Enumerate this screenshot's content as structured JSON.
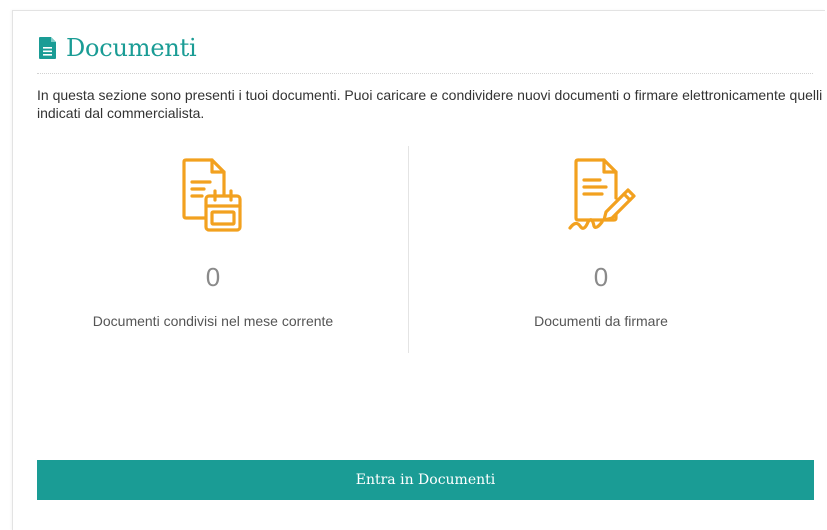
{
  "header": {
    "title": "Documenti",
    "icon": "document-icon"
  },
  "intro_text": "In questa sezione sono presenti i tuoi documenti. Puoi caricare e condividere nuovi documenti o firmare elettronicamente quelli indicati dal commercialista.",
  "stats": [
    {
      "icon": "shared-document-calendar-icon",
      "value": "0",
      "label": "Documenti condivisi nel mese corrente"
    },
    {
      "icon": "document-signature-icon",
      "value": "0",
      "label": "Documenti da firmare"
    }
  ],
  "cta": {
    "label": "Entra in Documenti"
  },
  "colors": {
    "accent": "#1a9c95",
    "icon_orange": "#f2a11f",
    "value_gray": "#8a8a8a"
  }
}
